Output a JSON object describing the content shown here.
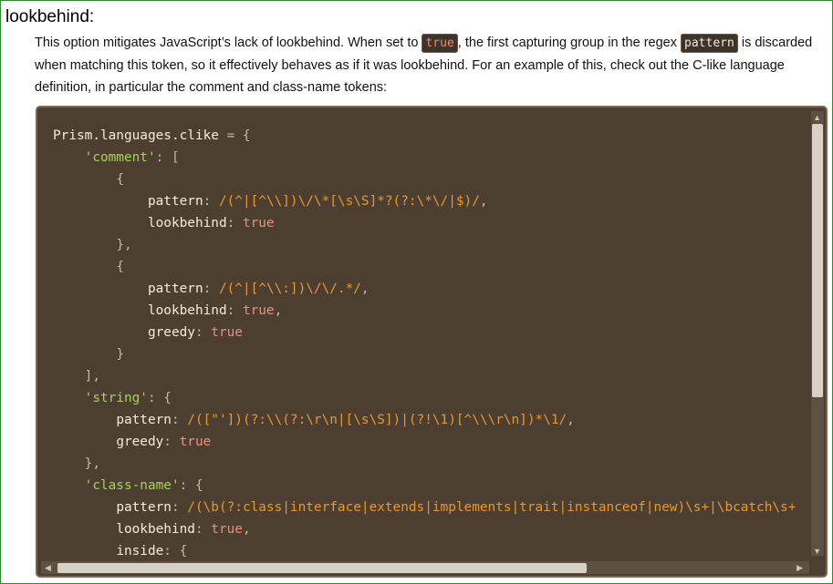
{
  "heading": "lookbehind:",
  "paragraph": {
    "p1": "This option mitigates JavaScript’s lack of lookbehind. When set to ",
    "code_true": "true",
    "p2": ", the first capturing group in the regex ",
    "code_pattern": "pattern",
    "p3": " is discarded when matching this token, so it effectively behaves as if it was lookbehind. For an example of this, check out the C-like language definition, in particular the comment and class-name tokens:"
  },
  "code": {
    "lines": [
      [
        [
          "prop",
          "Prism.languages.clike "
        ],
        [
          "punc",
          "= {"
        ]
      ],
      [
        [
          "plain",
          "    "
        ],
        [
          "str",
          "'comment'"
        ],
        [
          "punc",
          ": ["
        ]
      ],
      [
        [
          "plain",
          "        "
        ],
        [
          "punc",
          "{"
        ]
      ],
      [
        [
          "plain",
          "            "
        ],
        [
          "prop",
          "pattern"
        ],
        [
          "punc",
          ": "
        ],
        [
          "regex",
          "/(^|[^\\\\])\\/\\*[\\s\\S]*?(?:\\*\\/|$)/"
        ],
        [
          "punc",
          ","
        ]
      ],
      [
        [
          "plain",
          "            "
        ],
        [
          "prop",
          "lookbehind"
        ],
        [
          "punc",
          ": "
        ],
        [
          "bool",
          "true"
        ]
      ],
      [
        [
          "plain",
          "        "
        ],
        [
          "punc",
          "},"
        ]
      ],
      [
        [
          "plain",
          "        "
        ],
        [
          "punc",
          "{"
        ]
      ],
      [
        [
          "plain",
          "            "
        ],
        [
          "prop",
          "pattern"
        ],
        [
          "punc",
          ": "
        ],
        [
          "regex",
          "/(^|[^\\\\:])\\/\\/.*/"
        ],
        [
          "punc",
          ","
        ]
      ],
      [
        [
          "plain",
          "            "
        ],
        [
          "prop",
          "lookbehind"
        ],
        [
          "punc",
          ": "
        ],
        [
          "bool",
          "true"
        ],
        [
          "punc",
          ","
        ]
      ],
      [
        [
          "plain",
          "            "
        ],
        [
          "prop",
          "greedy"
        ],
        [
          "punc",
          ": "
        ],
        [
          "bool",
          "true"
        ]
      ],
      [
        [
          "plain",
          "        "
        ],
        [
          "punc",
          "}"
        ]
      ],
      [
        [
          "plain",
          "    "
        ],
        [
          "punc",
          "],"
        ]
      ],
      [
        [
          "plain",
          "    "
        ],
        [
          "str",
          "'string'"
        ],
        [
          "punc",
          ": {"
        ]
      ],
      [
        [
          "plain",
          "        "
        ],
        [
          "prop",
          "pattern"
        ],
        [
          "punc",
          ": "
        ],
        [
          "regex",
          "/([\"'])(?:\\\\(?:\\r\\n|[\\s\\S])|(?!\\1)[^\\\\\\r\\n])*\\1/"
        ],
        [
          "punc",
          ","
        ]
      ],
      [
        [
          "plain",
          "        "
        ],
        [
          "prop",
          "greedy"
        ],
        [
          "punc",
          ": "
        ],
        [
          "bool",
          "true"
        ]
      ],
      [
        [
          "plain",
          "    "
        ],
        [
          "punc",
          "},"
        ]
      ],
      [
        [
          "plain",
          "    "
        ],
        [
          "str",
          "'class-name'"
        ],
        [
          "punc",
          ": {"
        ]
      ],
      [
        [
          "plain",
          "        "
        ],
        [
          "prop",
          "pattern"
        ],
        [
          "punc",
          ": "
        ],
        [
          "regex",
          "/(\\b(?:class|interface|extends|implements|trait|instanceof|new)\\s+|\\bcatch\\s+"
        ]
      ],
      [
        [
          "plain",
          "        "
        ],
        [
          "prop",
          "lookbehind"
        ],
        [
          "punc",
          ": "
        ],
        [
          "bool",
          "true"
        ],
        [
          "punc",
          ","
        ]
      ],
      [
        [
          "plain",
          "        "
        ],
        [
          "prop",
          "inside"
        ],
        [
          "punc",
          ": {"
        ]
      ]
    ]
  },
  "icons": {
    "up": "▲",
    "down": "▼",
    "left": "◀",
    "right": "▶"
  }
}
